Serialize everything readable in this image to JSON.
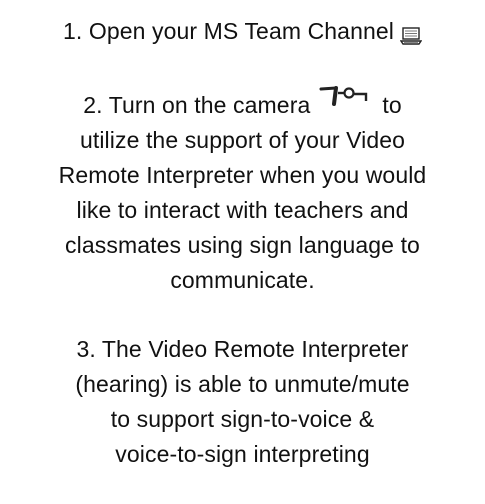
{
  "steps": [
    {
      "lines": [
        "1. Open your MS Team Channel"
      ],
      "icon": "laptop-icon"
    },
    {
      "lines": [
        "2. Turn on the camera",
        "to",
        "utilize the support of your Video",
        "Remote Interpreter when you would",
        "like to interact with teachers and",
        "classmates using sign language to",
        "communicate."
      ],
      "icon": "camera-toggle-icon"
    },
    {
      "lines": [
        "3. The Video Remote Interpreter",
        "(hearing) is able to unmute/mute",
        "to support sign-to-voice &",
        "voice-to-sign interpreting"
      ]
    }
  ]
}
